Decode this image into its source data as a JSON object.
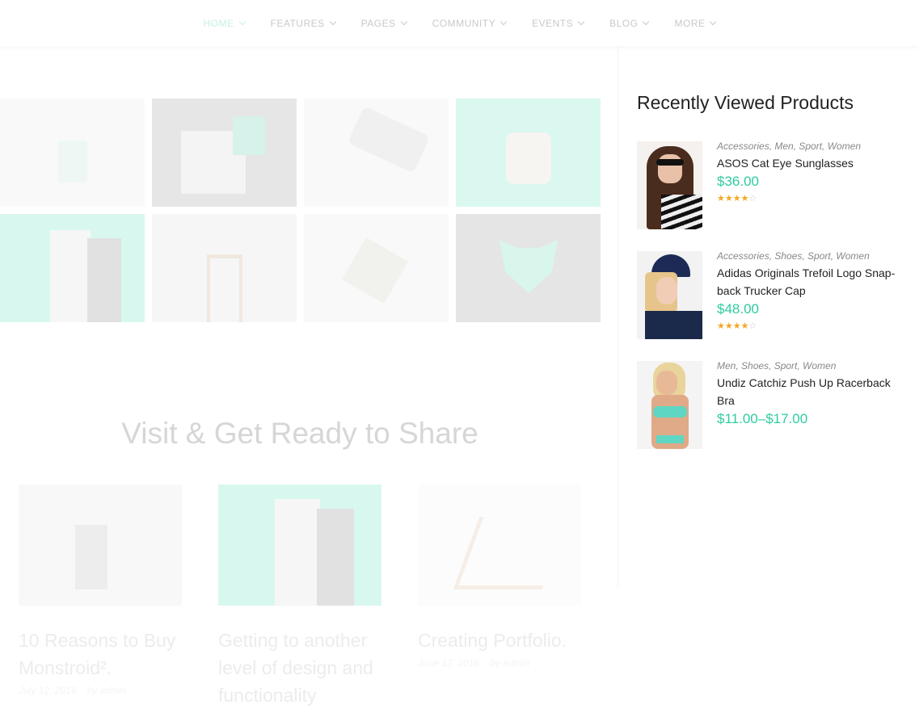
{
  "nav": {
    "items": [
      {
        "label": "HOME",
        "active": true
      },
      {
        "label": "FEATURES"
      },
      {
        "label": "PAGES"
      },
      {
        "label": "COMMUNITY"
      },
      {
        "label": "EVENTS"
      },
      {
        "label": "BLOG"
      },
      {
        "label": "MORE"
      }
    ]
  },
  "section_title": "Visit & Get Ready to Share",
  "posts": [
    {
      "title": "10 Reasons to Buy Monstroid².",
      "date": "July 12, 2016",
      "author": "by admin"
    },
    {
      "title": "Getting to another level of design and functionality",
      "date": "",
      "author": ""
    },
    {
      "title": "Creating Portfolio.",
      "date": "June 12, 2016",
      "author": "by admin"
    }
  ],
  "sidebar": {
    "title": "Recently Viewed Products",
    "products": [
      {
        "categories": "Accessories, Men, Sport, Women",
        "name": "ASOS Cat Eye Sunglasses",
        "price": "$36.00",
        "rating": 4
      },
      {
        "categories": "Accessories, Shoes, Sport, Women",
        "name": "Adidas Originals Trefoil Logo Snap-back Trucker Cap",
        "price": "$48.00",
        "rating": 4
      },
      {
        "categories": "Men, Shoes, Sport, Women",
        "name": "Undiz Catchiz Push Up Racerback Bra",
        "price": "$11.00–$17.00"
      }
    ]
  },
  "colors": {
    "accent": "#2dcca0",
    "mint": "#d8f8ef"
  }
}
